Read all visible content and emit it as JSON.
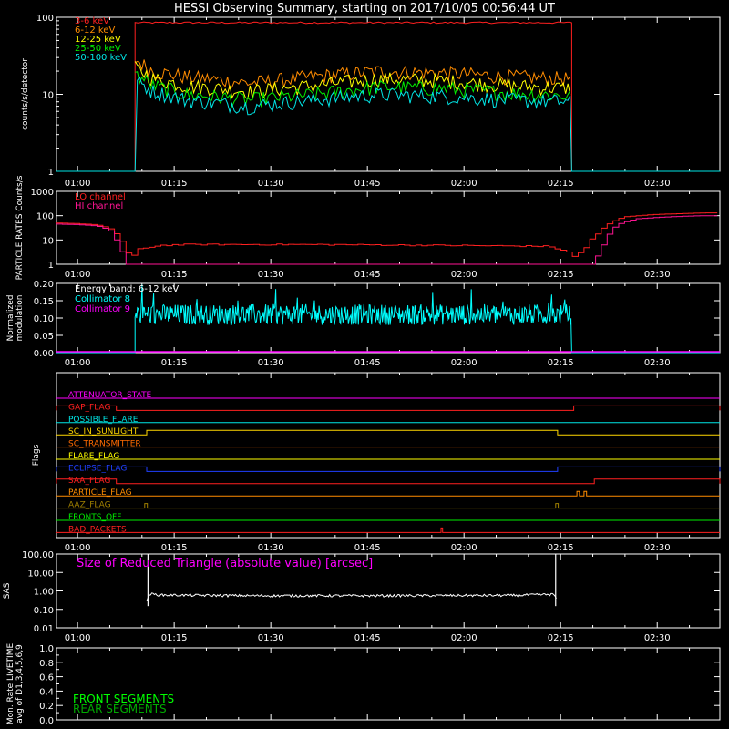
{
  "title": "HESSI Observing Summary, starting on 2017/10/05 00:56:44 UT",
  "time_axis": {
    "start": "00:56:44",
    "range_minutes": [
      0,
      103
    ],
    "ticks": [
      "01:00",
      "01:15",
      "01:30",
      "01:45",
      "02:00",
      "02:15",
      "02:30"
    ],
    "tick_minutes": [
      3.27,
      18.27,
      33.27,
      48.27,
      63.27,
      78.27,
      93.27
    ]
  },
  "colors": {
    "3-6 keV": "#ff2020",
    "6-12 keV": "#ff8c00",
    "12-25 keV": "#ffff00",
    "25-50 keV": "#00ee00",
    "50-100 keV": "#00e5e5",
    "lo": "#ff2020",
    "hi": "#ff1493",
    "coll8": "#00ffff",
    "coll9": "#ff00ff",
    "front": "#00ff00",
    "rear": "#00aa00"
  },
  "chart_data": [
    {
      "type": "line",
      "panel": "count_rates",
      "ylabel": "counts/s/detector",
      "yscale": "log",
      "ylim": [
        1,
        100
      ],
      "ytick_labels": [
        "1",
        "10",
        "100"
      ],
      "legend_placement": "top-left",
      "series": [
        {
          "name": "3-6 keV",
          "x": [
            0,
            12.2,
            12.2,
            80,
            80,
            103
          ],
          "y": [
            0,
            0,
            85,
            85,
            0,
            0
          ]
        },
        {
          "name": "6-12 keV",
          "x": [
            12.2,
            15,
            20,
            30,
            40,
            50,
            60,
            70,
            80
          ],
          "y": [
            28,
            20,
            17,
            14,
            17,
            20,
            19,
            17,
            16
          ]
        },
        {
          "name": "12-25 keV",
          "x": [
            12.2,
            15,
            20,
            30,
            40,
            50,
            60,
            70,
            80
          ],
          "y": [
            22,
            16,
            13,
            11,
            13,
            16,
            15,
            13,
            12
          ]
        },
        {
          "name": "25-50 keV",
          "x": [
            12.2,
            15,
            20,
            30,
            40,
            50,
            60,
            70,
            80
          ],
          "y": [
            18,
            13,
            10,
            8.5,
            10,
            12.5,
            12,
            10.5,
            9.5
          ]
        },
        {
          "name": "50-100 keV",
          "x": [
            0,
            12.2,
            12.2,
            15,
            20,
            30,
            40,
            50,
            60,
            70,
            80,
            80,
            103
          ],
          "y": [
            0,
            0,
            15,
            11,
            8.5,
            7,
            8.5,
            10,
            9.5,
            8.5,
            8,
            0,
            0
          ]
        }
      ]
    },
    {
      "type": "line",
      "panel": "particle_rates",
      "ylabel": "PARTICLE RATES Counts/s",
      "yscale": "log",
      "ylim": [
        1,
        1000
      ],
      "ytick_labels": [
        "1",
        "10",
        "100",
        "1000"
      ],
      "legend_placement": "top-left",
      "series": [
        {
          "name": "LO channel",
          "x": [
            0,
            3,
            6,
            8,
            9.5,
            10.5,
            11,
            11.5,
            12.2,
            16,
            20,
            40,
            60,
            76,
            78,
            79.5,
            80,
            81,
            82,
            84,
            86,
            88,
            92,
            96,
            100,
            103
          ],
          "y": [
            50,
            47,
            42,
            30,
            12,
            4,
            2.2,
            1.7,
            4,
            6,
            6.5,
            6.5,
            6,
            5.5,
            4,
            3,
            2,
            3,
            5,
            20,
            55,
            90,
            110,
            120,
            130,
            130
          ]
        },
        {
          "name": "HI channel",
          "x": [
            0,
            3,
            6,
            8,
            9,
            10,
            10.3,
            10.5,
            83.2,
            83.5,
            85,
            87,
            90,
            95,
            100,
            103
          ],
          "y": [
            45,
            43,
            38,
            25,
            10,
            2.5,
            1.2,
            1,
            1,
            1.3,
            8,
            45,
            75,
            90,
            100,
            100
          ]
        }
      ]
    },
    {
      "type": "line",
      "panel": "modulation",
      "ylabel": "Normalized modulation",
      "ylim": [
        0,
        0.2
      ],
      "ytick_labels": [
        "0.00",
        "0.05",
        "0.10",
        "0.15",
        "0.20"
      ],
      "legend_placement": "top-left",
      "annotation": "Energy band: 6-12 keV",
      "series": [
        {
          "name": "Collimator 8",
          "x_range": [
            12.2,
            80
          ],
          "mean": 0.11,
          "spread": 0.03,
          "peak": 0.2
        },
        {
          "name": "Collimator 9",
          "x": [
            0,
            103
          ],
          "y": [
            0,
            0
          ]
        }
      ]
    },
    {
      "type": "line",
      "panel": "flags",
      "ylabel": "Flags",
      "series": [
        {
          "name": "ATTENUATOR_STATE",
          "color": "#ff00ff",
          "high_intervals": []
        },
        {
          "name": "GAP_FLAG",
          "color": "#ff2020",
          "high_intervals": [
            [
              0,
              9.3
            ],
            [
              80.3,
              103
            ]
          ]
        },
        {
          "name": "POSSIBLE_FLARE",
          "color": "#00e5e5",
          "high_intervals": []
        },
        {
          "name": "SC_IN_SUNLIGHT",
          "color": "#ffd700",
          "high_intervals": [
            [
              14,
              77.8
            ]
          ]
        },
        {
          "name": "SC_TRANSMITTER",
          "color": "#ff6a00",
          "high_intervals": []
        },
        {
          "name": "FLARE_FLAG",
          "color": "#ffff00",
          "high_intervals": []
        },
        {
          "name": "ECLIPSE_FLAG",
          "color": "#2040ff",
          "high_intervals": [
            [
              0,
              14
            ],
            [
              77.8,
              103
            ]
          ]
        },
        {
          "name": "SAA_FLAG",
          "color": "#ff2020",
          "high_intervals": [
            [
              0,
              9.3
            ],
            [
              83.5,
              103
            ]
          ]
        },
        {
          "name": "PARTICLE_FLAG",
          "color": "#ff8c00",
          "high_intervals": [
            [
              80.8,
              81.2
            ],
            [
              81.9,
              82.3
            ]
          ]
        },
        {
          "name": "AAZ_FLAG",
          "color": "#a08000",
          "high_intervals": [
            [
              13.7,
              14.1
            ],
            [
              77.5,
              77.9
            ]
          ]
        },
        {
          "name": "FRONTS_OFF",
          "color": "#00ee00",
          "high_intervals": []
        },
        {
          "name": "BAD_PACKETS",
          "color": "#ff2020",
          "high_intervals": [
            [
              59.7,
              59.95
            ]
          ]
        }
      ]
    },
    {
      "type": "line",
      "panel": "sas",
      "ylabel": "SAS",
      "yscale": "log",
      "ylim": [
        0.01,
        100
      ],
      "ytick_labels": [
        "0.01",
        "0.10",
        "1.00",
        "10.00",
        "100.00"
      ],
      "annotation": "Size of Reduced Triangle (absolute value) [arcsec]",
      "series": [
        {
          "name": "triangle",
          "x": [
            14,
            14.5,
            16,
            30,
            50,
            70,
            77.2,
            77.7
          ],
          "y": [
            0.25,
            0.7,
            0.6,
            0.55,
            0.55,
            0.57,
            0.65,
            0.3
          ],
          "spikes": [
            14.2,
            77.5
          ]
        }
      ]
    },
    {
      "type": "line",
      "panel": "livetime",
      "ylabel": "Mon. Rate LIVETIME avg of D1,3,4,5,6,9",
      "ylim": [
        0,
        1
      ],
      "ytick_labels": [
        "0.0",
        "0.2",
        "0.4",
        "0.6",
        "0.8",
        "1.0"
      ],
      "legend": [
        "FRONT SEGMENTS",
        "REAR SEGMENTS"
      ],
      "series": []
    }
  ]
}
